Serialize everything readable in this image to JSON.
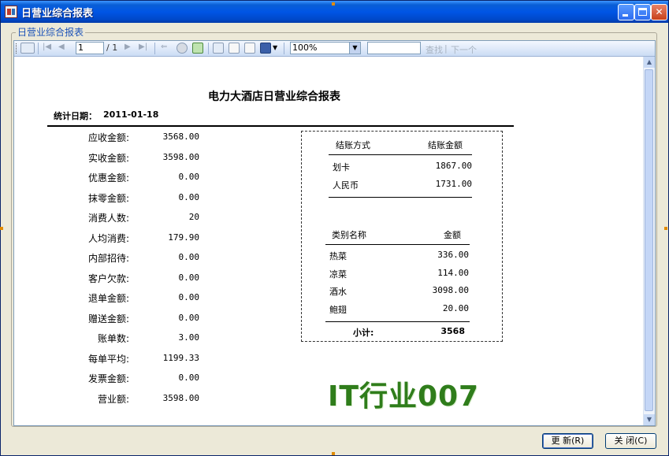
{
  "window": {
    "title": "日营业综合报表"
  },
  "group": {
    "label": "日营业综合报表"
  },
  "toolbar": {
    "page_current": "1",
    "page_total": "/ 1",
    "zoom": "100%",
    "find_label": "查找",
    "next_label": "下一个",
    "search_value": ""
  },
  "report": {
    "title": "电力大酒店日营业综合报表",
    "date_label": "统计日期：",
    "date_value": "2011-01-18",
    "metrics": [
      {
        "label": "应收金额:",
        "value": "3568.00"
      },
      {
        "label": "实收金额:",
        "value": "3598.00"
      },
      {
        "label": "优惠金额:",
        "value": "0.00"
      },
      {
        "label": "抹零金额:",
        "value": "0.00"
      },
      {
        "label": "消费人数:",
        "value": "20"
      },
      {
        "label": "人均消费:",
        "value": "179.90"
      },
      {
        "label": "内部招待:",
        "value": "0.00"
      },
      {
        "label": "客户欠款:",
        "value": "0.00"
      },
      {
        "label": "退单金额:",
        "value": "0.00"
      },
      {
        "label": "赠送金额:",
        "value": "0.00"
      },
      {
        "label": "账单数:",
        "value": "3.00"
      },
      {
        "label": "每单平均:",
        "value": "1199.33"
      },
      {
        "label": "发票金额:",
        "value": "0.00"
      },
      {
        "label": "营业额:",
        "value": "3598.00"
      }
    ],
    "payment_table": {
      "headers": [
        "结账方式",
        "结账金额"
      ],
      "rows": [
        {
          "method": "划卡",
          "amount": "1867.00"
        },
        {
          "method": "人民币",
          "amount": "1731.00"
        }
      ]
    },
    "category_table": {
      "headers": [
        "类别名称",
        "金额"
      ],
      "rows": [
        {
          "name": "热菜",
          "amount": "336.00"
        },
        {
          "name": "凉菜",
          "amount": "114.00"
        },
        {
          "name": "酒水",
          "amount": "3098.00"
        },
        {
          "name": "鲍翅",
          "amount": "20.00"
        }
      ],
      "subtotal_label": "小计:",
      "subtotal_value": "3568"
    },
    "watermark": "IT行业007"
  },
  "buttons": {
    "refresh": "更  新(R)",
    "close": "关  闭(C)"
  },
  "colors": {
    "titlebar": "#0055e5",
    "watermark": "#2f7d1b",
    "group_label": "#1c52b8"
  }
}
